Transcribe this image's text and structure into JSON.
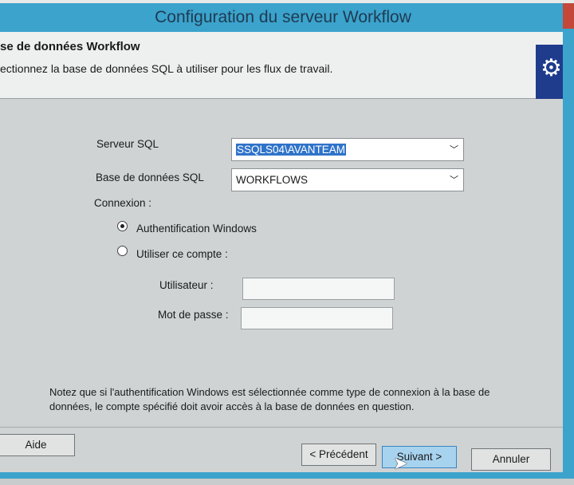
{
  "window": {
    "title": "Configuration du serveur Workflow"
  },
  "header": {
    "title": "se de données Workflow",
    "subtitle": "ectionnez la base de données SQL à utiliser pour les flux de travail."
  },
  "form": {
    "sql_server_label": "Serveur SQL",
    "sql_server_value": "SSQLS04\\AVANTEAM",
    "database_label": "Base de données SQL",
    "database_value": "WORKFLOWS",
    "connection_label": "Connexion :",
    "radio_windows": "Authentification Windows",
    "radio_account": "Utiliser ce compte :",
    "user_label": "Utilisateur :",
    "password_label": "Mot de passe :",
    "user_value": "",
    "password_value": ""
  },
  "note": "Notez que si l'authentification Windows est sélectionnée comme type de connexion à la base de données, le compte spécifié doit avoir accès à la base de données en question.",
  "buttons": {
    "help": "Aide",
    "previous": "< Précédent",
    "next": "Suivant >",
    "cancel": "Annuler"
  }
}
